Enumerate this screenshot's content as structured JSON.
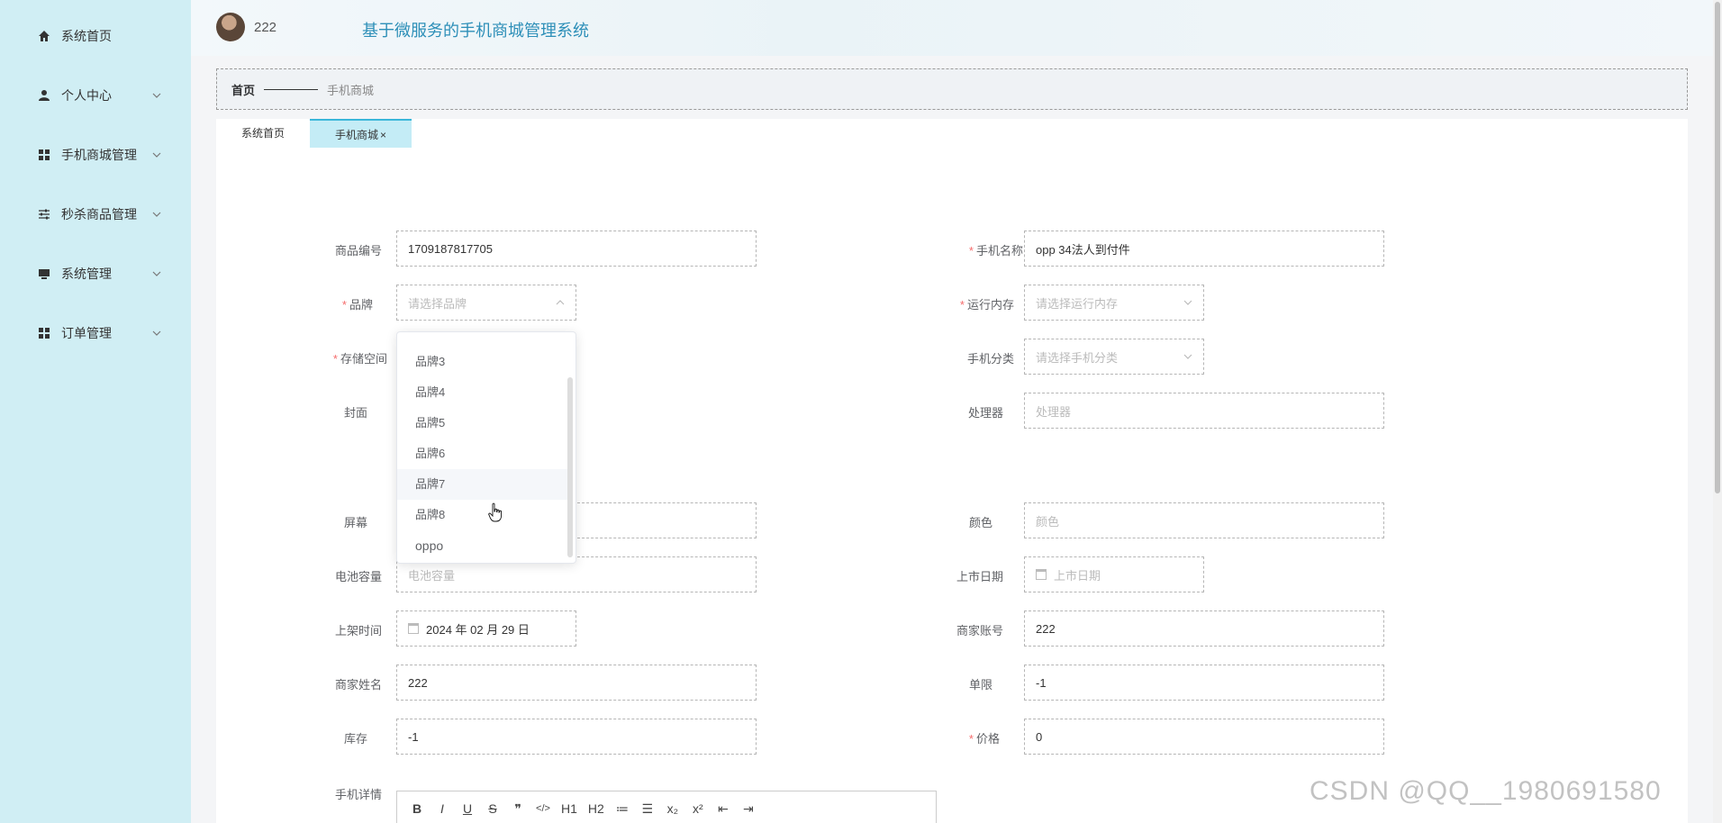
{
  "sidebar": {
    "items": [
      {
        "label": "系统首页",
        "icon": "home-icon"
      },
      {
        "label": "个人中心",
        "icon": "user-icon"
      },
      {
        "label": "手机商城管理",
        "icon": "grid-icon"
      },
      {
        "label": "秒杀商品管理",
        "icon": "sliders-icon"
      },
      {
        "label": "系统管理",
        "icon": "monitor-icon"
      },
      {
        "label": "订单管理",
        "icon": "grid-icon"
      }
    ]
  },
  "header": {
    "username": "222",
    "title": "基于微服务的手机商城管理系统"
  },
  "breadcrumb": {
    "home": "首页",
    "current": "手机商城"
  },
  "tabs": [
    {
      "label": "系统首页"
    },
    {
      "label": "手机商城",
      "close": "×"
    }
  ],
  "form": {
    "product_no": {
      "label": "商品编号",
      "value": "1709187817705"
    },
    "phone_name": {
      "label": "手机名称",
      "value": "opp   34法人到付件",
      "required": "*"
    },
    "brand": {
      "label": "品牌",
      "placeholder": "请选择品牌",
      "required": "*"
    },
    "ram": {
      "label": "运行内存",
      "placeholder": "请选择运行内存",
      "required": "*"
    },
    "storage": {
      "label": "存储空间",
      "required": "*"
    },
    "category": {
      "label": "手机分类",
      "placeholder": "请选择手机分类"
    },
    "cover": {
      "label": "封面"
    },
    "processor": {
      "label": "处理器",
      "placeholder": "处理器"
    },
    "screen": {
      "label": "屏幕"
    },
    "color": {
      "label": "颜色",
      "placeholder": "颜色"
    },
    "battery": {
      "label": "电池容量",
      "placeholder": "电池容量"
    },
    "release_date": {
      "label": "上市日期",
      "placeholder": "上市日期"
    },
    "listing_time": {
      "label": "上架时间",
      "value": "2024 年 02 月 29 日"
    },
    "merchant_account": {
      "label": "商家账号",
      "value": "222"
    },
    "merchant_name": {
      "label": "商家姓名",
      "value": "222"
    },
    "limit": {
      "label": "单限",
      "value": "-1"
    },
    "stock": {
      "label": "库存",
      "value": "-1"
    },
    "price": {
      "label": "价格",
      "value": "0",
      "required": "*"
    },
    "details": {
      "label": "手机详情"
    }
  },
  "brand_dropdown": {
    "options": [
      "品牌3",
      "品牌4",
      "品牌5",
      "品牌6",
      "品牌7",
      "品牌8",
      "oppo"
    ],
    "hovered": "品牌7"
  },
  "editor_toolbar": [
    "B",
    "I",
    "U",
    "S",
    "❞",
    "</>",
    "H1",
    "H2",
    "≔",
    "☰",
    "x₂",
    "x²",
    "⇤",
    "⇥"
  ],
  "watermark": "CSDN @QQ__1980691580",
  "colors": {
    "sidebar_bg": "#d0eef4",
    "title_color": "#2d8fb8",
    "active_tab_bg": "#c4ecf6",
    "required_color": "#f56c6c"
  }
}
